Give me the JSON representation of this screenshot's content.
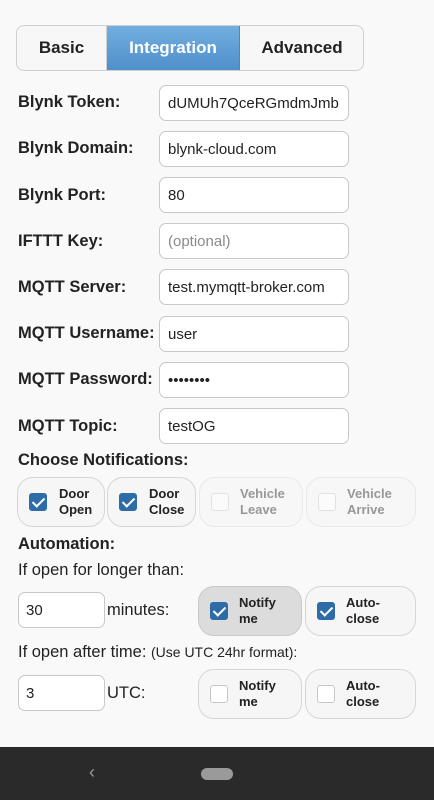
{
  "tabs": [
    "Basic",
    "Integration",
    "Advanced"
  ],
  "fields": [
    {
      "label": "Blynk Token:",
      "value": "dUMUh7QceRGmdmJmb",
      "placeholder": ""
    },
    {
      "label": "Blynk Domain:",
      "value": "blynk-cloud.com",
      "placeholder": ""
    },
    {
      "label": "Blynk Port:",
      "value": "80",
      "placeholder": ""
    },
    {
      "label": "IFTTT Key:",
      "value": "",
      "placeholder": "(optional)"
    },
    {
      "label": "MQTT Server:",
      "value": "test.mymqtt-broker.com",
      "placeholder": ""
    },
    {
      "label": "MQTT Username:",
      "value": "user",
      "placeholder": ""
    },
    {
      "label": "MQTT Password:",
      "value": "••••••••",
      "placeholder": ""
    },
    {
      "label": "MQTT Topic:",
      "value": "testOG",
      "placeholder": ""
    }
  ],
  "notifications": {
    "heading": "Choose Notifications:",
    "options": [
      {
        "line1": "Door",
        "line2": "Open",
        "checked": true,
        "enabled": true
      },
      {
        "line1": "Door",
        "line2": "Close",
        "checked": true,
        "enabled": true
      },
      {
        "line1": "Vehicle",
        "line2": "Leave",
        "checked": false,
        "enabled": false
      },
      {
        "line1": "Vehicle",
        "line2": "Arrive",
        "checked": false,
        "enabled": false
      }
    ]
  },
  "automation": {
    "heading": "Automation:",
    "longer": {
      "label": "If open for longer than:",
      "value": "30",
      "unit": "minutes:",
      "notify": {
        "line1": "Notify",
        "line2": "me",
        "checked": true
      },
      "autoclose": {
        "line1": "Auto-",
        "line2": "close",
        "checked": true
      }
    },
    "after": {
      "label": "If open after time:",
      "hint": "(Use UTC 24hr format):",
      "value": "3",
      "unit": "UTC:",
      "notify": {
        "line1": "Notify",
        "line2": "me",
        "checked": false
      },
      "autoclose": {
        "line1": "Auto-",
        "line2": "close",
        "checked": false
      }
    }
  },
  "nav": {
    "back": "‹"
  },
  "colors": {
    "accent": "#4f8fcc",
    "check": "#2e6ca7"
  }
}
